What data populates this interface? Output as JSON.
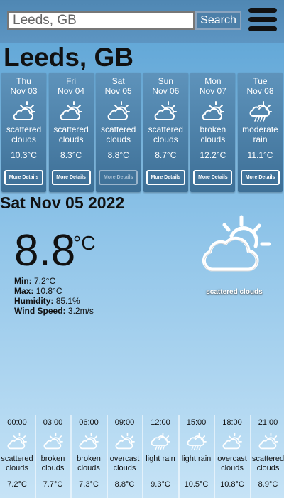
{
  "search": {
    "value": "Leeds, GB",
    "button_label": "Search"
  },
  "city": "Leeds, GB",
  "days": [
    {
      "name": "Thu",
      "date": "Nov 03",
      "icon": "cloud-sun-icon",
      "desc": "scattered clouds",
      "temp": "10.3°C",
      "button": "More Details",
      "selected": false
    },
    {
      "name": "Fri",
      "date": "Nov 04",
      "icon": "cloud-sun-icon",
      "desc": "scattered clouds",
      "temp": "8.3°C",
      "button": "More Details",
      "selected": false
    },
    {
      "name": "Sat",
      "date": "Nov 05",
      "icon": "cloud-sun-icon",
      "desc": "scattered clouds",
      "temp": "8.8°C",
      "button": "More Details",
      "selected": true
    },
    {
      "name": "Sun",
      "date": "Nov 06",
      "icon": "cloud-sun-icon",
      "desc": "scattered clouds",
      "temp": "8.7°C",
      "button": "More Details",
      "selected": false
    },
    {
      "name": "Mon",
      "date": "Nov 07",
      "icon": "cloud-sun-icon",
      "desc": "broken clouds",
      "temp": "12.2°C",
      "button": "More Details",
      "selected": false
    },
    {
      "name": "Tue",
      "date": "Nov 08",
      "icon": "rain-icon",
      "desc": "moderate rain",
      "temp": "11.1°C",
      "button": "More Details",
      "selected": false
    }
  ],
  "selected": {
    "date": "Sat Nov 05 2022",
    "temp": "8.8",
    "unit": "°C",
    "min_label": "Min:",
    "min": "7.2°C",
    "max_label": "Max:",
    "max": "10.8°C",
    "humidity_label": "Humidity:",
    "humidity": "85.1%",
    "wind_label": "Wind Speed:",
    "wind": "3.2m/s",
    "desc": "scattered clouds",
    "icon": "cloud-sun-icon"
  },
  "hours": [
    {
      "time": "00:00",
      "icon": "cloud-sun-icon",
      "desc": "scattered clouds",
      "temp": "7.2°C"
    },
    {
      "time": "03:00",
      "icon": "cloud-sun-icon",
      "desc": "broken clouds",
      "temp": "7.7°C"
    },
    {
      "time": "06:00",
      "icon": "cloud-sun-icon",
      "desc": "broken clouds",
      "temp": "7.3°C"
    },
    {
      "time": "09:00",
      "icon": "cloud-sun-icon",
      "desc": "overcast clouds",
      "temp": "8.8°C"
    },
    {
      "time": "12:00",
      "icon": "rain-icon",
      "desc": "light rain",
      "temp": "9.3°C"
    },
    {
      "time": "15:00",
      "icon": "rain-icon",
      "desc": "light rain",
      "temp": "10.5°C"
    },
    {
      "time": "18:00",
      "icon": "cloud-sun-icon",
      "desc": "overcast clouds",
      "temp": "10.8°C"
    },
    {
      "time": "21:00",
      "icon": "cloud-sun-icon",
      "desc": "scattered clouds",
      "temp": "8.9°C"
    }
  ]
}
